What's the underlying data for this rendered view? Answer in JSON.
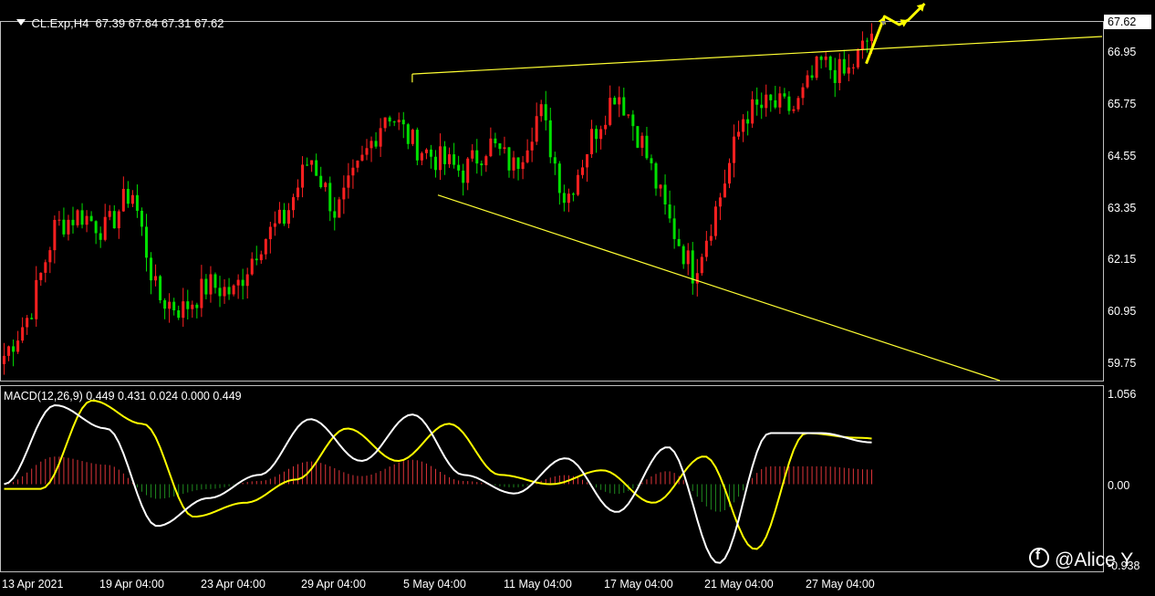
{
  "header": {
    "symbol_line": "CL.Exp,H4  67.39 67.64 67.31 67.62"
  },
  "price_axis": {
    "labels": [
      "66.95",
      "65.75",
      "64.55",
      "63.35",
      "62.15",
      "60.95",
      "59.75"
    ],
    "current_price": "67.62"
  },
  "macd": {
    "label": "MACD(12,26,9) 0.449 0.431 0.024 0.000 0.449",
    "axis_labels": [
      "1.056",
      "0.00",
      "-0.938"
    ]
  },
  "time_axis": {
    "labels": [
      "13 Apr 2021",
      "19 Apr 04:00",
      "23 Apr 04:00",
      "29 Apr 04:00",
      "5 May 04:00",
      "11 May 04:00",
      "17 May 04:00",
      "21 May 04:00",
      "27 May 04:00"
    ]
  },
  "watermark": {
    "text": "@Alice Y"
  },
  "colors": {
    "background": "#000000",
    "bull": "#ff2020",
    "bear": "#00e000",
    "trendline": "#ffff33",
    "arrow": "#ffff00",
    "macd_line": "#ffffff",
    "signal_line": "#ffff00",
    "hist_pos": "#e0353a",
    "hist_neg": "#1f8a1f"
  },
  "chart_data": [
    {
      "type": "candlestick",
      "title": "CL.Exp,H4",
      "ylim": [
        59.3,
        67.9
      ],
      "close_path": [
        [
          "13 Apr",
          59.9
        ],
        [
          "14 Apr",
          60.9
        ],
        [
          "15 Apr",
          63.0
        ],
        [
          "16 Apr",
          63.3
        ],
        [
          "19 Apr",
          62.9
        ],
        [
          "20 Apr",
          63.9
        ],
        [
          "21 Apr",
          61.3
        ],
        [
          "22 Apr",
          61.0
        ],
        [
          "23 Apr",
          61.6
        ],
        [
          "26 Apr",
          61.4
        ],
        [
          "27 Apr",
          62.6
        ],
        [
          "28 Apr",
          63.2
        ],
        [
          "29 Apr",
          64.7
        ],
        [
          "30 Apr",
          63.3
        ],
        [
          "3 May",
          64.5
        ],
        [
          "4 May",
          65.8
        ],
        [
          "5 May",
          65.0
        ],
        [
          "6 May",
          64.6
        ],
        [
          "7 May",
          64.3
        ],
        [
          "10 May",
          65.0
        ],
        [
          "11 May",
          64.4
        ],
        [
          "12 May",
          65.8
        ],
        [
          "13 May",
          63.6
        ],
        [
          "14 May",
          65.1
        ],
        [
          "17 May",
          66.3
        ],
        [
          "18 May",
          65.0
        ],
        [
          "19 May",
          63.2
        ],
        [
          "20 May",
          61.9
        ],
        [
          "21 May",
          63.6
        ],
        [
          "24 May",
          65.7
        ],
        [
          "25 May",
          65.9
        ],
        [
          "26 May",
          65.8
        ],
        [
          "27 May",
          66.9
        ],
        [
          "28 May",
          66.6
        ],
        [
          "31 May",
          67.62
        ]
      ],
      "trendlines": [
        {
          "name": "upper",
          "from": [
            "5 May",
            66.65
          ],
          "to": [
            "end",
            67.55
          ]
        },
        {
          "name": "lower",
          "from": [
            "6 May",
            63.75
          ],
          "to": [
            "end",
            59.75
          ]
        }
      ]
    },
    {
      "type": "line",
      "title": "MACD(12,26,9)",
      "ylim": [
        -0.938,
        1.056
      ],
      "series": [
        {
          "name": "MACD",
          "values": [
            0.0,
            0.85,
            0.6,
            -0.45,
            -0.15,
            0.1,
            0.7,
            0.25,
            0.75,
            0.1,
            -0.1,
            0.28,
            -0.3,
            0.4,
            -0.85,
            0.55,
            0.55,
            0.45
          ]
        },
        {
          "name": "Signal",
          "values": [
            -0.05,
            0.9,
            0.65,
            -0.35,
            -0.2,
            0.05,
            0.6,
            0.25,
            0.65,
            0.1,
            0.0,
            0.15,
            -0.2,
            0.3,
            -0.7,
            0.55,
            0.5,
            0.45
          ]
        }
      ]
    }
  ]
}
